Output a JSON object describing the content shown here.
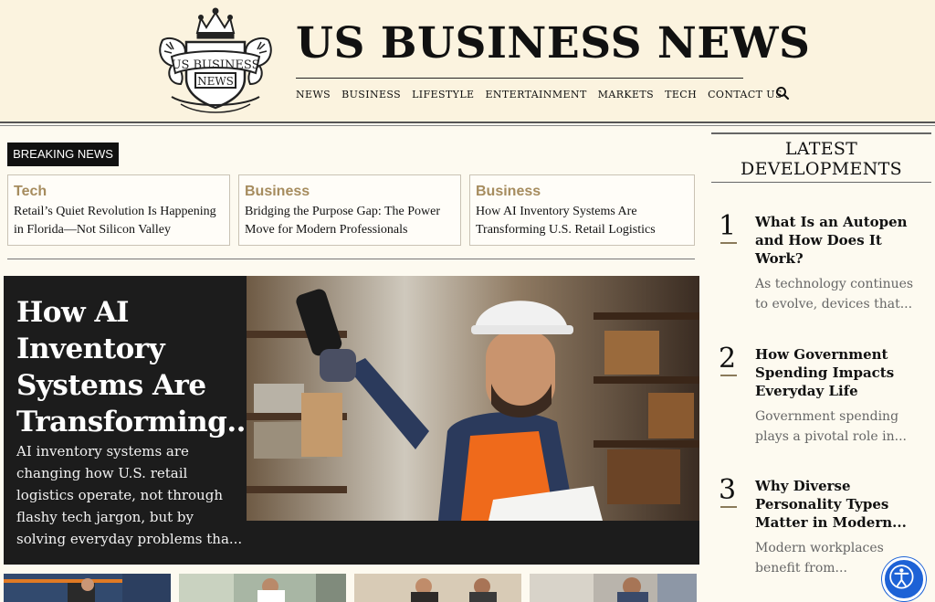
{
  "site": {
    "title": "US BUSINESS NEWS",
    "logo_text_top": "US BUSINESS",
    "logo_text_bottom": "NEWS"
  },
  "nav": {
    "items": [
      "NEWS",
      "BUSINESS",
      "LIFESTYLE",
      "ENTERTAINMENT",
      "MARKETS",
      "TECH",
      "CONTACT US"
    ],
    "search_icon": "search-icon"
  },
  "breaking": {
    "label": "BREAKING NEWS",
    "items": [
      {
        "category": "Tech",
        "title": "Retail’s Quiet Revolution Is Happening in Florida—Not Silicon Valley"
      },
      {
        "category": "Business",
        "title": "Bridging the Purpose Gap: The Power Move for Modern Professionals"
      },
      {
        "category": "Business",
        "title": "How AI Inventory Systems Are Transforming U.S. Retail Logistics"
      }
    ]
  },
  "featured": {
    "title": "How AI Inventory Systems Are Transforming...",
    "excerpt": "AI inventory systems are changing how U.S. retail logistics operate, not through flashy tech jargon, but by solving everyday problems tha..."
  },
  "sidebar": {
    "heading_line1": "LATEST",
    "heading_line2": "DEVELOPMENTS",
    "items": [
      {
        "number": "1",
        "title": "What Is an Autopen and How Does It Work?",
        "excerpt": "As technology continues to evolve, devices that..."
      },
      {
        "number": "2",
        "title": "How Government Spending Impacts Everyday Life",
        "excerpt": "Government spending plays a pivotal role in..."
      },
      {
        "number": "3",
        "title": "Why Diverse Personality Types Matter in Modern...",
        "excerpt": "Modern workplaces benefit from..."
      }
    ]
  },
  "colors": {
    "header_bg": "#fbf3df",
    "page_bg": "#fdfaf0",
    "category_accent": "#a68c5e",
    "featured_bg": "#1c1c1c",
    "accessibility_blue": "#1d62d6"
  },
  "accessibility": {
    "icon": "accessibility-icon"
  }
}
